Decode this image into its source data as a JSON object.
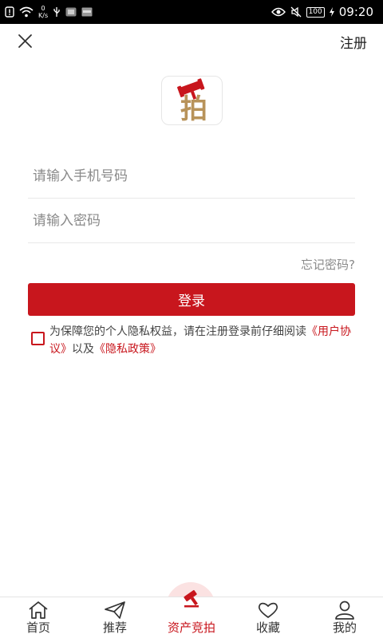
{
  "status_bar": {
    "speed_value": "0",
    "speed_unit": "K/s",
    "battery": "100",
    "time": "09:20"
  },
  "header": {
    "register_label": "注册"
  },
  "logo": {
    "text": "拍"
  },
  "form": {
    "phone_placeholder": "请输入手机号码",
    "password_placeholder": "请输入密码",
    "forgot_label": "忘记密码?",
    "login_label": "登录"
  },
  "agreement": {
    "prefix": "为保障您的个人隐私权益，请在注册登录前仔细阅读",
    "user_agreement": "《用户协议》",
    "and": "以及",
    "privacy_policy": "《隐私政策》"
  },
  "tabs": [
    {
      "label": "首页",
      "icon": "home-icon"
    },
    {
      "label": "推荐",
      "icon": "paper-plane-icon"
    },
    {
      "label": "资产竞拍",
      "icon": "gavel-icon"
    },
    {
      "label": "收藏",
      "icon": "heart-icon"
    },
    {
      "label": "我的",
      "icon": "user-icon"
    }
  ],
  "colors": {
    "accent": "#c8161d",
    "accent_light": "#fbe2e2",
    "logo_gold": "#b8935a"
  }
}
